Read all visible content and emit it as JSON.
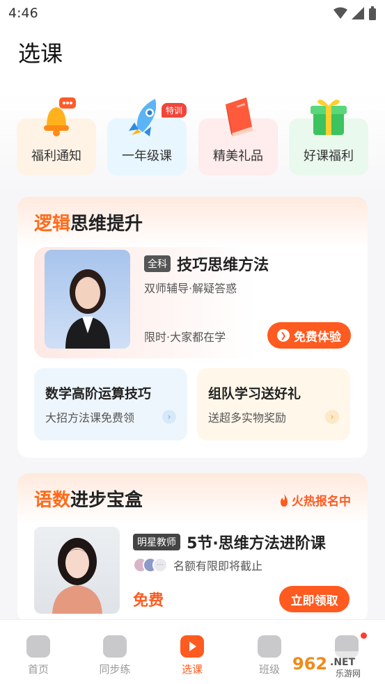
{
  "status_bar": {
    "time": "4:46"
  },
  "header": {
    "title": "选课"
  },
  "quick_links": [
    {
      "label": "福利通知",
      "icon": "bell-icon",
      "bg": "#fff3e6"
    },
    {
      "label": "一年级课",
      "icon": "rocket-icon",
      "bg": "#e8f6ff",
      "badge": "特训"
    },
    {
      "label": "精美礼品",
      "icon": "book-icon",
      "bg": "#ffecec"
    },
    {
      "label": "好课福利",
      "icon": "gift-icon",
      "bg": "#eaf9ee"
    }
  ],
  "logic_section": {
    "title_highlight": "逻辑",
    "title_rest": "思维提升",
    "course": {
      "tag": "全科",
      "name": "技巧思维方法",
      "subtitle": "双师辅导·解疑答惑",
      "note": "限时·大家都在学",
      "button": "免费体验"
    },
    "mini_cards": [
      {
        "title": "数学高阶运算技巧",
        "subtitle": "大招方法课免费领",
        "bg": "#eef6fd",
        "arrow_color": "#5aa7e0"
      },
      {
        "title": "组队学习送好礼",
        "subtitle": "送超多实物奖励",
        "bg": "#fff7ea",
        "arrow_color": "#f0a23c"
      }
    ]
  },
  "chinese_math_section": {
    "title_highlight": "语数",
    "title_rest": "进步宝盒",
    "hot_label": "火热报名中",
    "course": {
      "tag": "明星教师",
      "name": "5节·思维方法进阶课",
      "limit_text": "名额有限即将截止",
      "price": "免费",
      "button": "立即领取"
    }
  },
  "tabbar": {
    "tabs": [
      {
        "label": "首页",
        "active": false
      },
      {
        "label": "同步练",
        "active": false
      },
      {
        "label": "选课",
        "active": true
      },
      {
        "label": "班级",
        "active": false
      },
      {
        "label": "",
        "active": false
      }
    ]
  },
  "watermark": {
    "number": "962",
    "suffix": ".NET",
    "site": "乐游网"
  },
  "colors": {
    "accent": "#ff5a1f",
    "highlight": "#ff6a1a"
  }
}
